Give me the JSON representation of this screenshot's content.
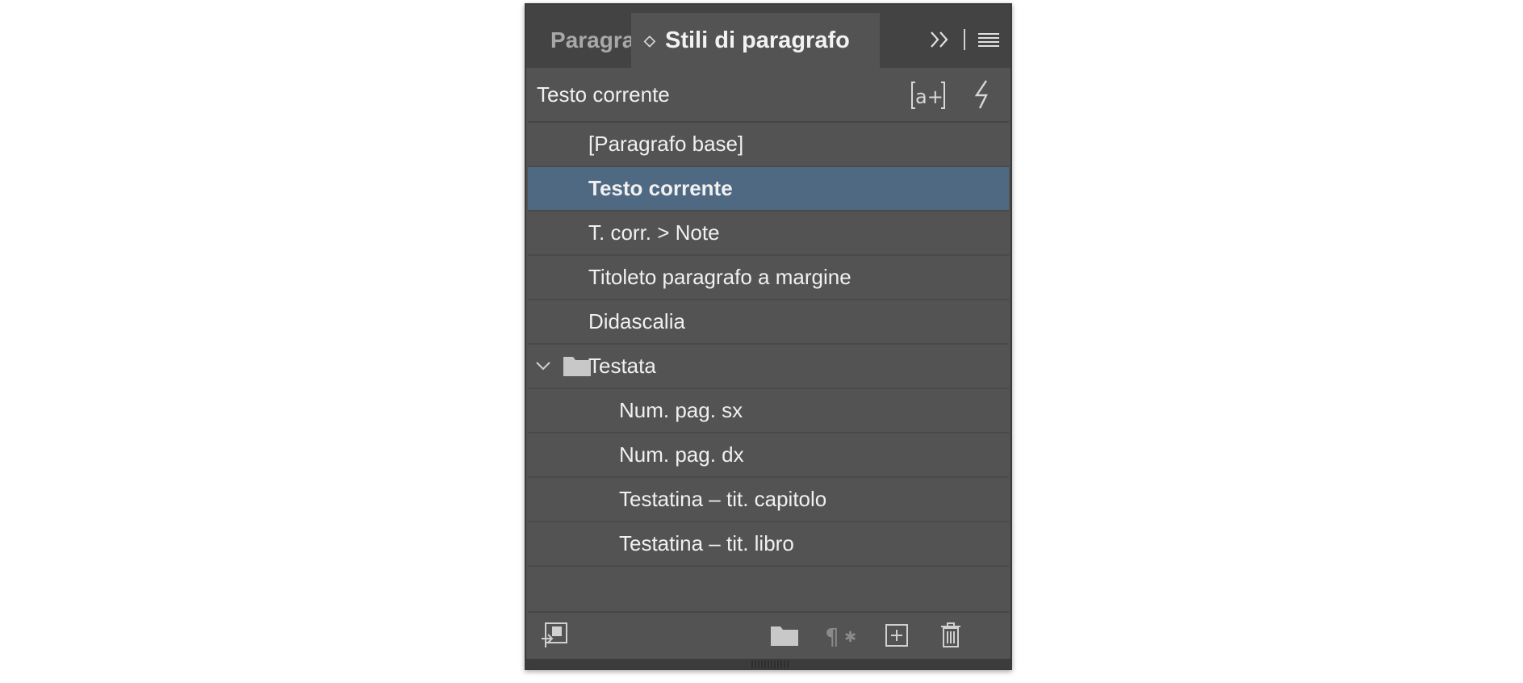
{
  "tabs": [
    {
      "label": "Paragrafo",
      "active": false
    },
    {
      "label": "Stili di paragrafo",
      "active": true
    }
  ],
  "header": {
    "current_style": "Testo corrente"
  },
  "styles": [
    {
      "label": "[Paragrafo base]",
      "indent": 1
    },
    {
      "label": "Testo corrente",
      "indent": 1,
      "selected": true
    },
    {
      "label": "T. corr. > Note",
      "indent": 1
    },
    {
      "label": "Titoleto paragrafo a margine",
      "indent": 1
    },
    {
      "label": "Didascalia",
      "indent": 1
    },
    {
      "label": "Testata",
      "indent": 1,
      "group": true,
      "expanded": true
    },
    {
      "label": "Num. pag. sx",
      "indent": 2
    },
    {
      "label": "Num. pag. dx",
      "indent": 2
    },
    {
      "label": "Testatina – tit. capitolo",
      "indent": 2
    },
    {
      "label": "Testatina – tit. libro",
      "indent": 2
    }
  ],
  "icons": {
    "collapse": "double-chevron-right-icon",
    "menu": "panel-menu-icon",
    "new_override": "new-style-override-icon",
    "quick_apply": "lightning-icon",
    "load_styles": "load-styles-icon",
    "new_group": "folder-icon",
    "clear_overrides": "clear-overrides-icon",
    "new_style": "new-style-icon",
    "delete": "trash-icon"
  },
  "colors": {
    "panel_bg": "#535353",
    "tabbar_bg": "#434343",
    "selection": "#4f6983",
    "text": "#f0f0f0"
  }
}
